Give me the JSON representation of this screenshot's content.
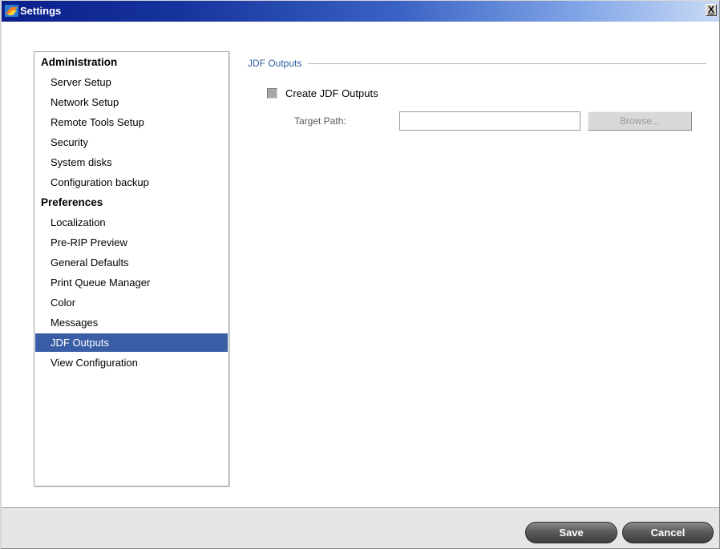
{
  "window": {
    "title": "Settings",
    "close_glyph": "X"
  },
  "nav": {
    "groups": [
      {
        "label": "Administration",
        "items": [
          "Server Setup",
          "Network Setup",
          "Remote Tools Setup",
          "Security",
          "System disks",
          "Configuration backup"
        ]
      },
      {
        "label": "Preferences",
        "items": [
          "Localization",
          "Pre-RIP Preview",
          "General Defaults",
          "Print Queue Manager",
          "Color",
          "Messages",
          "JDF Outputs",
          "View Configuration"
        ]
      }
    ],
    "selected": "JDF Outputs"
  },
  "panel": {
    "section_title": "JDF Outputs",
    "checkbox_label": "Create JDF Outputs",
    "checkbox_checked": false,
    "target_path_label": "Target Path:",
    "target_path_value": "",
    "browse_label": "Browse..."
  },
  "footer": {
    "save_label": "Save",
    "cancel_label": "Cancel"
  },
  "colors": {
    "selection": "#3a5ea6",
    "section_title": "#2e5b9e",
    "titlebar_start": "#0a1f8c",
    "titlebar_end": "#c9daf6"
  },
  "icons": {
    "app": "app-logo-icon",
    "close": "close-icon"
  }
}
